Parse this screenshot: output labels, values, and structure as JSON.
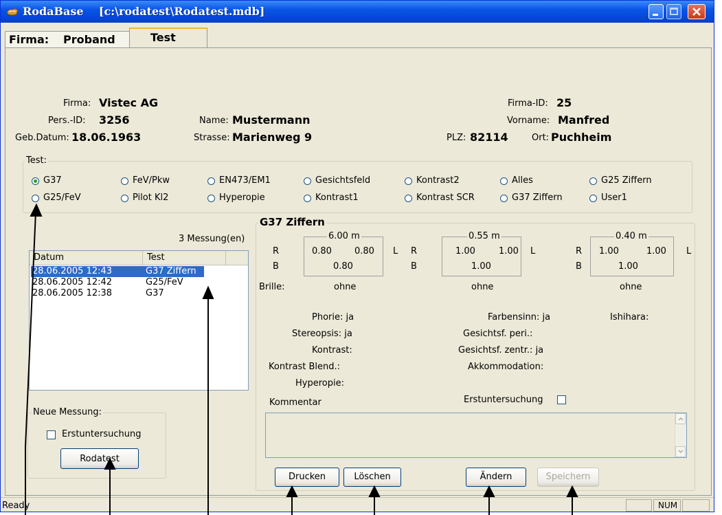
{
  "window": {
    "title": "RodaBase    [c:\\rodatest\\Rodatest.mdb]"
  },
  "tabs": [
    "Firma:",
    "Proband",
    "Test"
  ],
  "header": {
    "firma_label": "Firma:",
    "firma_value": "Vistec AG",
    "firma_id_label": "Firma-ID:",
    "firma_id_value": "25",
    "pers_id_label": "Pers.-ID:",
    "pers_id_value": "3256",
    "name_label": "Name:",
    "name_value": "Mustermann",
    "vorname_label": "Vorname:",
    "vorname_value": "Manfred",
    "geb_label": "Geb.Datum:",
    "geb_value": "18.06.1963",
    "strasse_label": "Strasse:",
    "strasse_value": "Marienweg 9",
    "plz_label": "PLZ:",
    "plz_value": "82114",
    "ort_label": "Ort:",
    "ort_value": "Puchheim"
  },
  "test_group": {
    "title": "Test:",
    "options": [
      "G37",
      "FeV/Pkw",
      "EN473/EM1",
      "Gesichtsfeld",
      "Kontrast2",
      "Alles",
      "G25 Ziffern",
      "G25/FeV",
      "Pilot Kl2",
      "Hyperopie",
      "Kontrast1",
      "Kontrast SCR",
      "G37 Ziffern",
      "User1"
    ],
    "selected": "G37"
  },
  "measurements": {
    "count": "3 Messung(en)",
    "columns": [
      "Datum",
      "Test"
    ],
    "rows": [
      [
        "28.06.2005 12:43",
        "G37 Ziffern"
      ],
      [
        "28.06.2005 12:42",
        "G25/FeV"
      ],
      [
        "28.06.2005 12:38",
        "G37"
      ]
    ]
  },
  "new_measurement": {
    "title": "Neue Messung:",
    "checkbox_label": "Erstuntersuchung",
    "button": "Rodatest"
  },
  "result": {
    "title": "G37 Ziffern",
    "distances": [
      {
        "label": "6.00 m",
        "r": "0.80",
        "l": "0.80",
        "b": "0.80",
        "brille": "ohne"
      },
      {
        "label": "0.55 m",
        "r": "1.00",
        "l": "1.00",
        "b": "1.00",
        "brille": "ohne"
      },
      {
        "label": "0.40 m",
        "r": "1.00",
        "l": "1.00",
        "b": "1.00",
        "brille": "ohne"
      }
    ],
    "r_label": "R",
    "l_label": "L",
    "b_label": "B",
    "brille_label": "Brille:",
    "phorie": "Phorie: ja",
    "stereopsis": "Stereopsis: ja",
    "kontrast": "Kontrast:",
    "kontrast_blend": "Kontrast Blend.:",
    "hyperopie": "Hyperopie:",
    "farbensinn": "Farbensinn: ja",
    "gesichtsf_peri": "Gesichtsf. peri.:",
    "gesichtsf_zentr": "Gesichtsf. zentr.: ja",
    "akkommodation": "Akkommodation:",
    "ishihara": "Ishihara:",
    "kommentar_label": "Kommentar",
    "erstuntersuchung_label": "Erstuntersuchung"
  },
  "buttons": {
    "drucken": "Drucken",
    "loeschen": "Löschen",
    "aendern": "Ändern",
    "speichern": "Speichern"
  },
  "status": {
    "text": "Ready",
    "num": "NUM"
  }
}
